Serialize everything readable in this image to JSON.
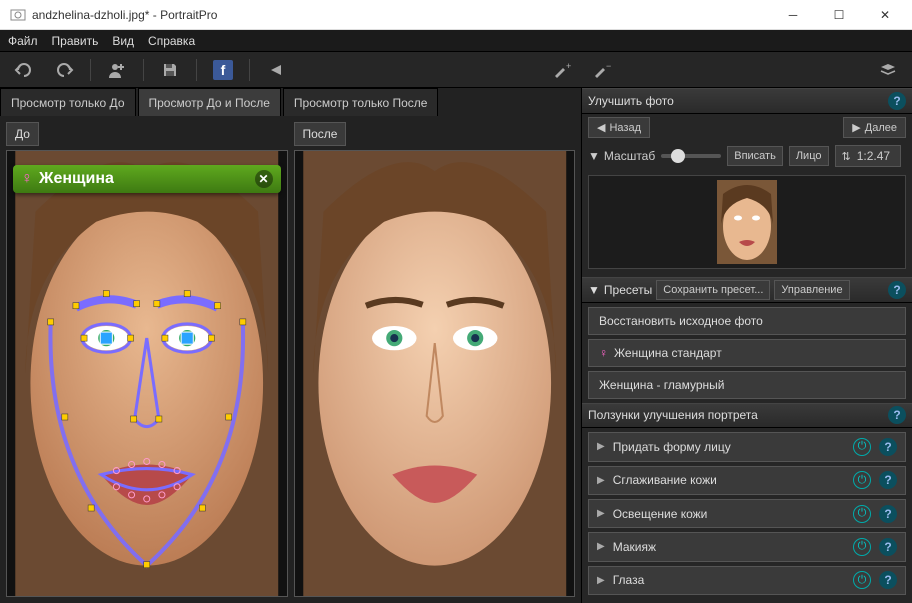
{
  "window": {
    "title": "andzhelina-dzholi.jpg* - PortraitPro"
  },
  "menu": {
    "file": "Файл",
    "edit": "Править",
    "view": "Вид",
    "help": "Справка"
  },
  "view_tabs": {
    "before_only": "Просмотр только До",
    "before_after": "Просмотр До и После",
    "after_only": "Просмотр только После"
  },
  "labels": {
    "before": "До",
    "after": "После"
  },
  "gender_badge": {
    "symbol": "♀",
    "text": "Женщина"
  },
  "right": {
    "enhance_title": "Улучшить фото",
    "back": "Назад",
    "next": "Далее",
    "scale_label": "Масштаб",
    "fit": "Вписать",
    "face": "Лицо",
    "zoom_readout": "1:2.47",
    "presets_label": "Пресеты",
    "save_preset": "Сохранить пресет...",
    "manage": "Управление",
    "presets": [
      "Восстановить исходное фото",
      "Женщина стандарт",
      "Женщина - гламурный"
    ],
    "sliders_title": "Ползунки улучшения портрета",
    "sliders": [
      "Придать форму лицу",
      "Сглаживание кожи",
      "Освещение кожи",
      "Макияж",
      "Глаза"
    ]
  }
}
